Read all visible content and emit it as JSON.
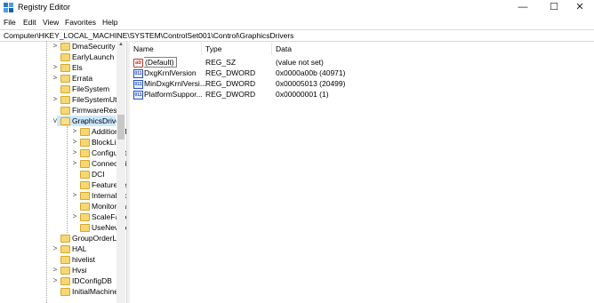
{
  "window": {
    "title": "Registry Editor",
    "minimize": "—",
    "maximize": "☐",
    "close": "✕"
  },
  "menu": [
    "File",
    "Edit",
    "View",
    "Favorites",
    "Help"
  ],
  "address": "Computer\\HKEY_LOCAL_MACHINE\\SYSTEM\\ControlSet001\\Control\\GraphicsDrivers",
  "tree": [
    {
      "label": "DmaSecurity",
      "indent": 0,
      "chevron": ">"
    },
    {
      "label": "EarlyLaunch",
      "indent": 0,
      "chevron": ""
    },
    {
      "label": "Els",
      "indent": 0,
      "chevron": ">"
    },
    {
      "label": "Errata",
      "indent": 0,
      "chevron": ">"
    },
    {
      "label": "FileSystem",
      "indent": 0,
      "chevron": ""
    },
    {
      "label": "FileSystemUtil",
      "indent": 0,
      "chevron": ">"
    },
    {
      "label": "FirmwareReso",
      "indent": 0,
      "chevron": ""
    },
    {
      "label": "GraphicsDrive",
      "indent": 0,
      "chevron": "v",
      "selected": true,
      "open": true
    },
    {
      "label": "AdditionalM",
      "indent": 1,
      "chevron": ">"
    },
    {
      "label": "BlockList",
      "indent": 1,
      "chevron": ">"
    },
    {
      "label": "Configurati",
      "indent": 1,
      "chevron": ">"
    },
    {
      "label": "Connectivit",
      "indent": 1,
      "chevron": ">"
    },
    {
      "label": "DCI",
      "indent": 1,
      "chevron": ""
    },
    {
      "label": "FeatureSetU",
      "indent": 1,
      "chevron": ""
    },
    {
      "label": "InternalMo",
      "indent": 1,
      "chevron": ">"
    },
    {
      "label": "MonitorDat",
      "indent": 1,
      "chevron": ""
    },
    {
      "label": "ScaleFactor",
      "indent": 1,
      "chevron": ">"
    },
    {
      "label": "UseNewKey",
      "indent": 1,
      "chevron": ""
    },
    {
      "label": "GroupOrderLis",
      "indent": 0,
      "chevron": ""
    },
    {
      "label": "HAL",
      "indent": 0,
      "chevron": ">"
    },
    {
      "label": "hivelist",
      "indent": 0,
      "chevron": ""
    },
    {
      "label": "Hvsi",
      "indent": 0,
      "chevron": ">"
    },
    {
      "label": "IDConfigDB",
      "indent": 0,
      "chevron": ">"
    },
    {
      "label": "InitialMachine",
      "indent": 0,
      "chevron": ""
    }
  ],
  "columns": {
    "name": "Name",
    "type": "Type",
    "data": "Data"
  },
  "values": [
    {
      "icon": "string-value-icon",
      "glyph": "ab",
      "name": "(Default)",
      "type": "REG_SZ",
      "data": "(value not set)"
    },
    {
      "icon": "dword-value-icon",
      "glyph": "011",
      "name": "DxgKrnlVersion",
      "type": "REG_DWORD",
      "data": "0x0000a00b (40971)"
    },
    {
      "icon": "dword-value-icon",
      "glyph": "011",
      "name": "MinDxgKrnlVersi...",
      "type": "REG_DWORD",
      "data": "0x00005013 (20499)"
    },
    {
      "icon": "dword-value-icon",
      "glyph": "011",
      "name": "PlatformSuppor...",
      "type": "REG_DWORD",
      "data": "0x00000001 (1)"
    }
  ]
}
